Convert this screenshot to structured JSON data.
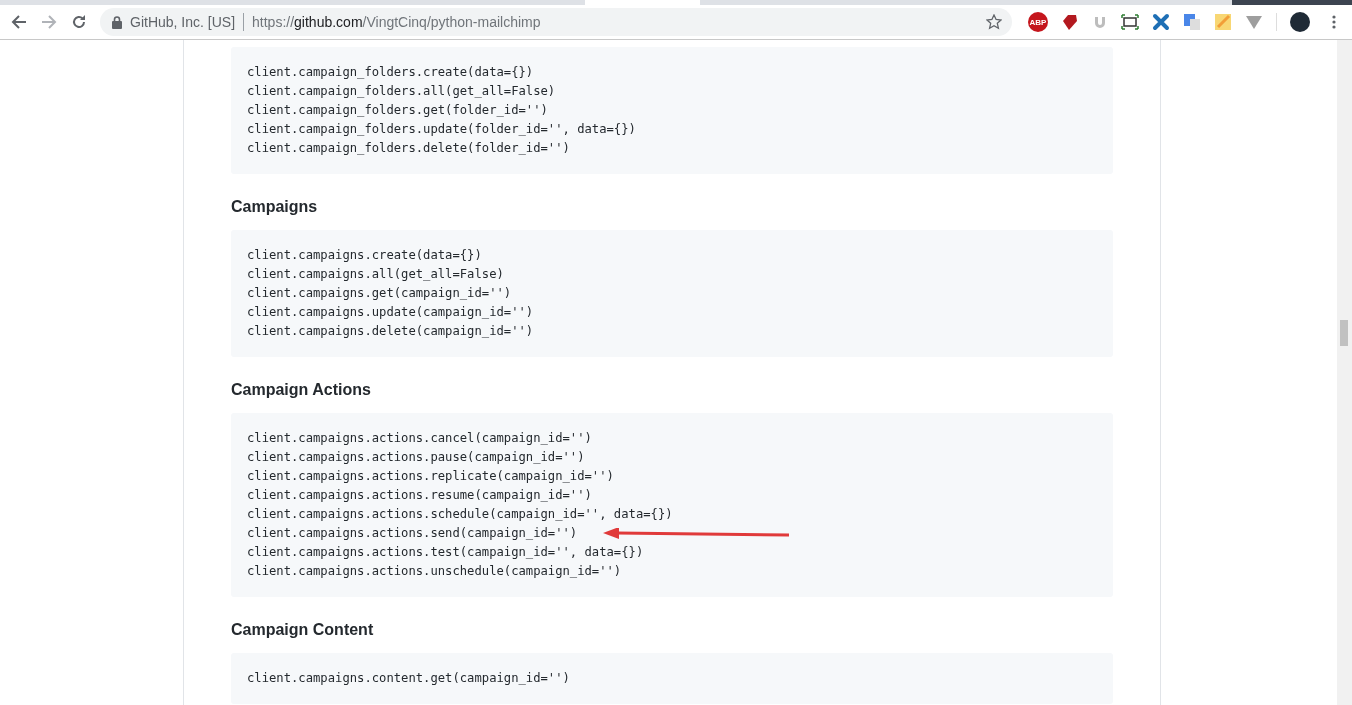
{
  "browser": {
    "site_identity": "GitHub, Inc. [US]",
    "url_scheme": "https://",
    "url_host": "github.com",
    "url_path": "/VingtCinq/python-mailchimp",
    "bookmarked": false,
    "abp_label": "ABP"
  },
  "sections": [
    {
      "lines": [
        {
          "text": "client.campaign_folders.create(data={})",
          "marked": false
        },
        {
          "text": "client.campaign_folders.all(get_all=False)",
          "marked": false
        },
        {
          "text": "client.campaign_folders.get(folder_id='')",
          "marked": false
        },
        {
          "text": "client.campaign_folders.update(folder_id='', data={})",
          "marked": false
        },
        {
          "text": "client.campaign_folders.delete(folder_id='')",
          "marked": false
        }
      ]
    },
    {
      "heading": "Campaigns",
      "lines": [
        {
          "text": "client.campaigns.create(data={})",
          "marked": false
        },
        {
          "text": "client.campaigns.all(get_all=False)",
          "marked": false
        },
        {
          "text": "client.campaigns.get(campaign_id='')",
          "marked": false
        },
        {
          "text": "client.campaigns.update(campaign_id='')",
          "marked": false
        },
        {
          "text": "client.campaigns.delete(campaign_id='')",
          "marked": false
        }
      ]
    },
    {
      "heading": "Campaign Actions",
      "lines": [
        {
          "text": "client.campaigns.actions.cancel(campaign_id='')",
          "marked": false
        },
        {
          "text": "client.campaigns.actions.pause(campaign_id='')",
          "marked": false
        },
        {
          "text": "client.campaigns.actions.replicate(campaign_id='')",
          "marked": false
        },
        {
          "text": "client.campaigns.actions.resume(campaign_id='')",
          "marked": false
        },
        {
          "text": "client.campaigns.actions.schedule(campaign_id='', data={})",
          "marked": false
        },
        {
          "text": "client.campaigns.actions.send(campaign_id='')",
          "marked": true
        },
        {
          "text": "client.campaigns.actions.test(campaign_id='', data={})",
          "marked": false
        },
        {
          "text": "client.campaigns.actions.unschedule(campaign_id='')",
          "marked": false
        }
      ]
    },
    {
      "heading": "Campaign Content",
      "lines": [
        {
          "text": "client.campaigns.content.get(campaign_id='')",
          "marked": false
        }
      ]
    }
  ]
}
